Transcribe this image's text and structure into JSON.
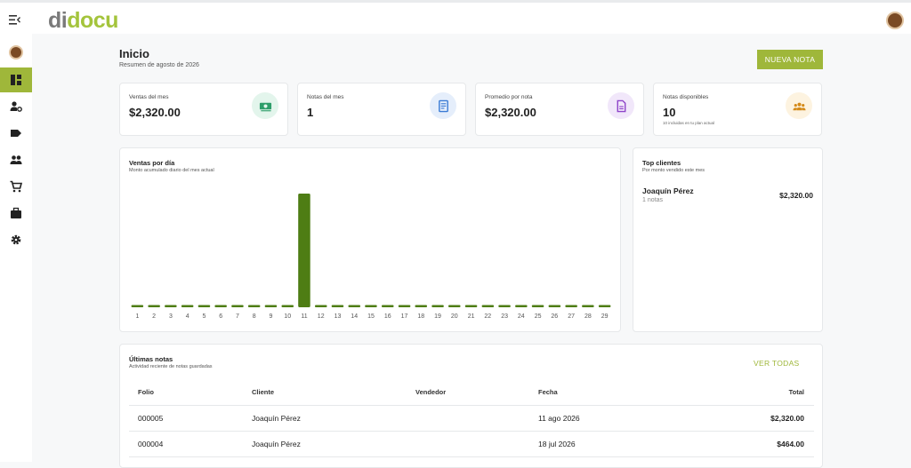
{
  "header": {
    "logo_a": "di",
    "logo_b": "docu"
  },
  "sidebar": {
    "items": [
      {
        "icon": "dashboard-icon",
        "active": true
      },
      {
        "icon": "user-settings-icon"
      },
      {
        "icon": "label-icon"
      },
      {
        "icon": "people-icon"
      },
      {
        "icon": "cart-icon"
      },
      {
        "icon": "briefcase-icon"
      },
      {
        "icon": "gear-icon"
      }
    ]
  },
  "page": {
    "title": "Inicio",
    "subtitle": "Resumen de agosto de 2026",
    "new_button": "NUEVA NOTA"
  },
  "stats": [
    {
      "label": "Ventas del mes",
      "value": "$2,320.00",
      "note": "",
      "icon": "money-icon",
      "color": "#2e9e6a",
      "bg": "#e3f5ec"
    },
    {
      "label": "Notas del mes",
      "value": "1",
      "note": "",
      "icon": "receipt-icon",
      "color": "#3a7bd5",
      "bg": "#e5eefb"
    },
    {
      "label": "Promedio por nota",
      "value": "$2,320.00",
      "note": "",
      "icon": "document-icon",
      "color": "#8e44c9",
      "bg": "#f1e7fa"
    },
    {
      "label": "Notas disponibles",
      "value": "10",
      "note": "10 incluidas en tu plan actual",
      "icon": "group-icon",
      "color": "#d48a1a",
      "bg": "#fdf3e0"
    }
  ],
  "sales_chart": {
    "title": "Ventas por día",
    "subtitle": "Monto acumulado diario del mes actual"
  },
  "chart_data": {
    "type": "bar",
    "categories": [
      "1",
      "2",
      "3",
      "4",
      "5",
      "6",
      "7",
      "8",
      "9",
      "10",
      "11",
      "12",
      "13",
      "14",
      "15",
      "16",
      "17",
      "18",
      "19",
      "20",
      "21",
      "22",
      "23",
      "24",
      "25",
      "26",
      "27",
      "28",
      "29"
    ],
    "values": [
      0,
      0,
      0,
      0,
      0,
      0,
      0,
      0,
      0,
      0,
      2320,
      0,
      0,
      0,
      0,
      0,
      0,
      0,
      0,
      0,
      0,
      0,
      0,
      0,
      0,
      0,
      0,
      0,
      0
    ],
    "ylim": [
      0,
      2320
    ],
    "color": "#4e7d14",
    "grid": false
  },
  "top_clients": {
    "title": "Top clientes",
    "subtitle": "Por monto vendido este mes",
    "items": [
      {
        "name": "Joaquín Pérez",
        "count": "1 notas",
        "amount": "$2,320.00"
      }
    ]
  },
  "latest_notes": {
    "title": "Últimas notas",
    "subtitle": "Actividad reciente de notas guardadas",
    "see_all": "VER TODAS",
    "columns": [
      "Folio",
      "Cliente",
      "Vendedor",
      "Fecha",
      "Total"
    ],
    "rows": [
      {
        "folio": "000005",
        "cliente": "Joaquín Pérez",
        "vendedor": "",
        "fecha": "11 ago 2026",
        "total": "$2,320.00"
      },
      {
        "folio": "000004",
        "cliente": "Joaquín Pérez",
        "vendedor": "",
        "fecha": "18 jul 2026",
        "total": "$464.00"
      }
    ]
  }
}
